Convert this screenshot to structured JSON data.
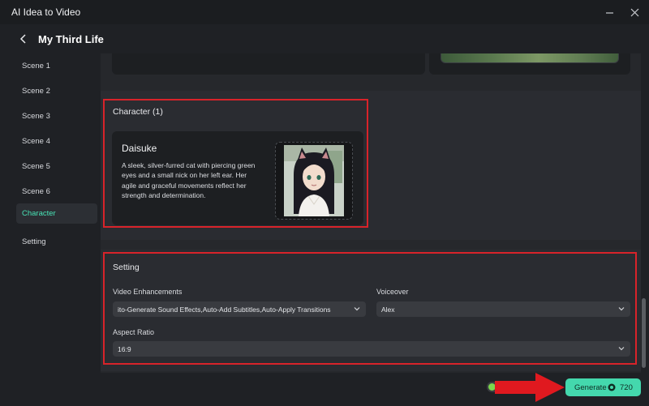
{
  "app": {
    "title": "AI Idea to Video"
  },
  "header": {
    "title": "My Third Life"
  },
  "sidebar": {
    "items": [
      {
        "label": "Scene 1"
      },
      {
        "label": "Scene 2"
      },
      {
        "label": "Scene 3"
      },
      {
        "label": "Scene 4"
      },
      {
        "label": "Scene 5"
      },
      {
        "label": "Scene 6"
      },
      {
        "label": "Character",
        "active": true
      },
      {
        "label": "Setting"
      }
    ]
  },
  "character": {
    "section_title": "Character (1)",
    "name": "Daisuke",
    "description": "A sleek, silver-furred cat with piercing green eyes and a small nick on her left ear. Her agile and graceful movements reflect her strength and determination."
  },
  "setting": {
    "section_title": "Setting",
    "video_enhancements_label": "Video Enhancements",
    "video_enhancements_value": "ito-Generate Sound Effects,Auto-Add Subtitles,Auto-Apply Transitions",
    "voiceover_label": "Voiceover",
    "voiceover_value": "Alex",
    "aspect_ratio_label": "Aspect Ratio",
    "aspect_ratio_value": "16:9"
  },
  "footer": {
    "generate_label": "Generate",
    "credits": "720"
  },
  "colors": {
    "accent": "#44d8ad",
    "highlight": "#d8232a",
    "background": "#1f2125"
  }
}
